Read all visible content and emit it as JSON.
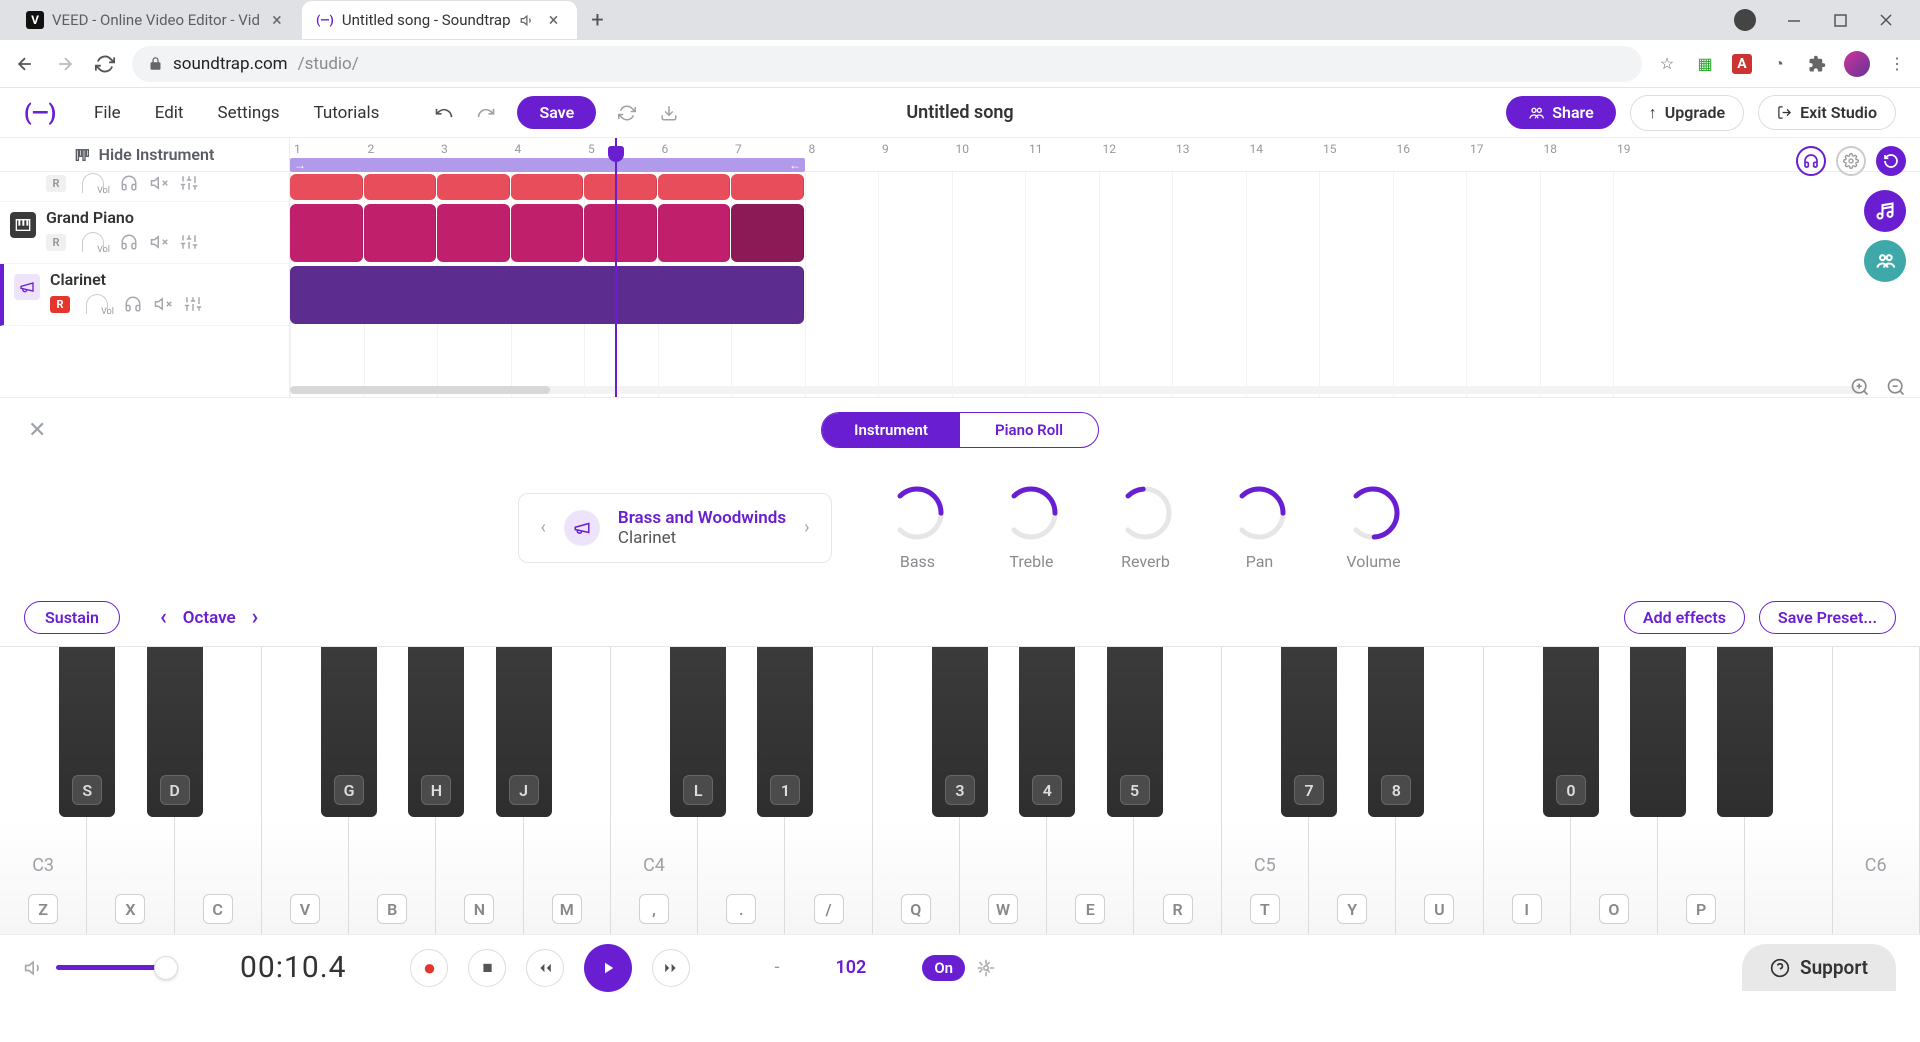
{
  "browser": {
    "tabs": [
      {
        "title": "VEED - Online Video Editor - Vid",
        "favicon": "V"
      },
      {
        "title": "Untitled song - Soundtrap",
        "favicon": "(—)",
        "active": true
      }
    ],
    "url_domain": "soundtrap.com",
    "url_path": "/studio/"
  },
  "header": {
    "menus": [
      "File",
      "Edit",
      "Settings",
      "Tutorials"
    ],
    "save": "Save",
    "title": "Untitled song",
    "share": "Share",
    "upgrade": "Upgrade",
    "exit": "Exit Studio"
  },
  "timeline": {
    "hide_instrument": "Hide Instrument",
    "markers": [
      1,
      2,
      3,
      4,
      5,
      6,
      7,
      8,
      9,
      10,
      11,
      12,
      13,
      14,
      15,
      16,
      17,
      18,
      19
    ],
    "tracks": [
      {
        "name": "",
        "recording": false
      },
      {
        "name": "Grand Piano",
        "recording": false
      },
      {
        "name": "Clarinet",
        "recording": true,
        "active": true
      }
    ]
  },
  "instrument_panel": {
    "tabs": {
      "instrument": "Instrument",
      "pianoroll": "Piano Roll"
    },
    "preset": {
      "category": "Brass and Woodwinds",
      "name": "Clarinet"
    },
    "knobs": [
      {
        "label": "Bass",
        "value": 0.5
      },
      {
        "label": "Treble",
        "value": 0.5
      },
      {
        "label": "Reverb",
        "value": 0.15
      },
      {
        "label": "Pan",
        "value": 0.5
      },
      {
        "label": "Volume",
        "value": 0.82
      }
    ],
    "sustain": "Sustain",
    "octave": "Octave",
    "add_effects": "Add effects",
    "save_preset": "Save Preset..."
  },
  "piano": {
    "c_labels": [
      "C3",
      "C4",
      "C5",
      "C6"
    ],
    "white_keys_kb": [
      "Z",
      "X",
      "C",
      "V",
      "B",
      "N",
      "M",
      ",",
      ".",
      "/",
      "Q",
      "W",
      "E",
      "R",
      "T",
      "Y",
      "U",
      "I",
      "O",
      "P",
      "",
      ""
    ],
    "black_keys_kb": [
      "S",
      "D",
      "",
      "G",
      "H",
      "J",
      "",
      "L",
      "1",
      "",
      "3",
      "4",
      "5",
      "",
      "7",
      "8",
      "",
      "0"
    ]
  },
  "transport": {
    "time": "00:10.4",
    "key_sig": "-",
    "bpm": "102",
    "metronome": "On",
    "support": "Support"
  }
}
